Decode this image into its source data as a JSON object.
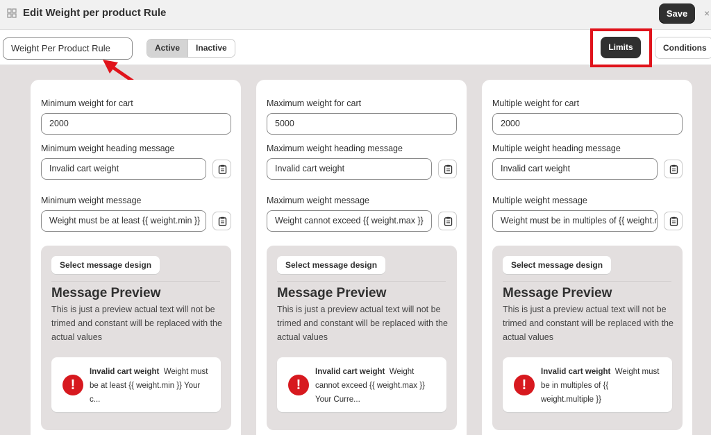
{
  "header": {
    "title": "Edit Weight per product Rule",
    "save_label": "Save",
    "close_glyph": "×",
    "app_icon": "grid-icon"
  },
  "toolbar": {
    "rule_name": "Weight Per Product Rule",
    "status_active": "Active",
    "status_inactive": "Inactive",
    "selected_status": "Active",
    "limits_label": "Limits",
    "conditions_label": "Conditions",
    "highlight_color": "#e0131b"
  },
  "cards": [
    {
      "weight_label": "Minimum weight for cart",
      "weight_value": "2000",
      "heading_label": "Minimum weight heading message",
      "heading_value": "Invalid cart weight",
      "message_label": "Minimum weight message",
      "message_value": "Weight must be at least {{ weight.min }}",
      "design_button": "Select message design",
      "preview_title": "Message Preview",
      "preview_desc": "This is just a preview actual text will not be trimed and constant will be replaced with the actual values",
      "preview_heading": "Invalid cart weight",
      "preview_body": "Weight must be at least {{ weight.min }} Your c..."
    },
    {
      "weight_label": "Maximum weight for cart",
      "weight_value": "5000",
      "heading_label": "Maximum weight heading message",
      "heading_value": "Invalid cart weight",
      "message_label": "Maximum weight message",
      "message_value": "Weight cannot exceed {{ weight.max }}",
      "design_button": "Select message design",
      "preview_title": "Message Preview",
      "preview_desc": "This is just a preview actual text will not be trimed and constant will be replaced with the actual values",
      "preview_heading": "Invalid cart weight",
      "preview_body": "Weight cannot exceed {{ weight.max }} Your Curre..."
    },
    {
      "weight_label": "Multiple weight for cart",
      "weight_value": "2000",
      "heading_label": "Multiple weight heading message",
      "heading_value": "Invalid cart weight",
      "message_label": "Multiple weight message",
      "message_value": "Weight must be in multiples of {{ weight.multiple }}",
      "design_button": "Select message design",
      "preview_title": "Message Preview",
      "preview_desc": "This is just a preview actual text will not be trimed and constant will be replaced with the actual values",
      "preview_heading": "Invalid cart weight",
      "preview_body": "Weight must be in multiples of {{ weight.multiple }}"
    }
  ],
  "icons": {
    "clipboard": "clipboard-icon",
    "error": "alert-icon",
    "error_glyph": "!"
  },
  "colors": {
    "primary_button": "#303030",
    "error_red": "#d7191f",
    "annotation_red": "#e0131b"
  }
}
